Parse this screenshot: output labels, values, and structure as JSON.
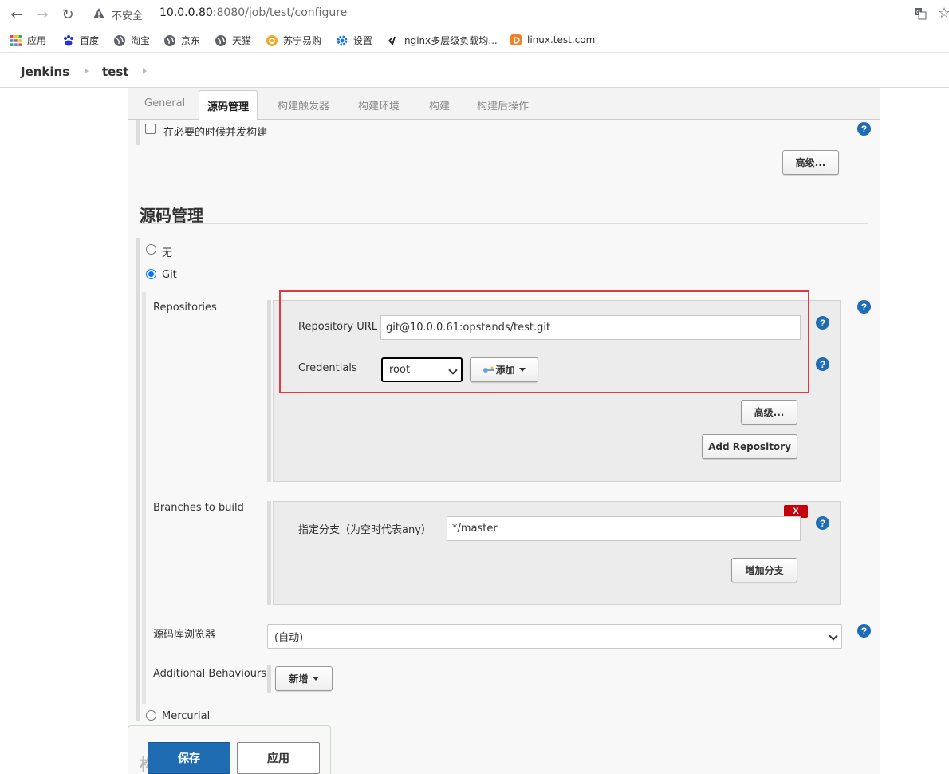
{
  "browser": {
    "insecure_label": "不安全",
    "url_host": "10.0.0.80",
    "url_rest": ":8080/job/test/configure"
  },
  "bookmarks": [
    {
      "label": "应用"
    },
    {
      "label": "百度"
    },
    {
      "label": "淘宝"
    },
    {
      "label": "京东"
    },
    {
      "label": "天猫"
    },
    {
      "label": "苏宁易购"
    },
    {
      "label": "设置"
    },
    {
      "label": "nginx多层级负载均..."
    },
    {
      "label": "linux.test.com"
    }
  ],
  "breadcrumbs": [
    "Jenkins",
    "test"
  ],
  "tabs": [
    "General",
    "源码管理",
    "构建触发器",
    "构建环境",
    "构建",
    "构建后操作"
  ],
  "general": {
    "concurrent_label": "在必要的时候并发构建",
    "advanced_label": "高级..."
  },
  "scm": {
    "title": "源码管理",
    "options": [
      "无",
      "Git",
      "Mercurial"
    ],
    "repositories_label": "Repositories",
    "repo_url_label": "Repository URL",
    "repo_url_value": "git@10.0.0.61:opstands/test.git",
    "credentials_label": "Credentials",
    "credentials_value": "root",
    "add_label": "添加",
    "repo_advanced_label": "高级...",
    "add_repository_label": "Add Repository",
    "branches_label": "Branches to build",
    "branch_spec_label": "指定分支（为空时代表any）",
    "branch_spec_value": "*/master",
    "delete_label": "X",
    "add_branch_label": "增加分支",
    "browser_label": "源码库浏览器",
    "browser_value": "(自动)",
    "behaviours_label": "Additional Behaviours",
    "new_label": "新增"
  },
  "footer": {
    "save_label": "保存",
    "apply_label": "应用",
    "cut_heading": "构"
  },
  "help_glyph": "?",
  "colors": {
    "accent": "#1f6cb3",
    "highlight": "#e0393e",
    "danger": "#c4000a"
  }
}
